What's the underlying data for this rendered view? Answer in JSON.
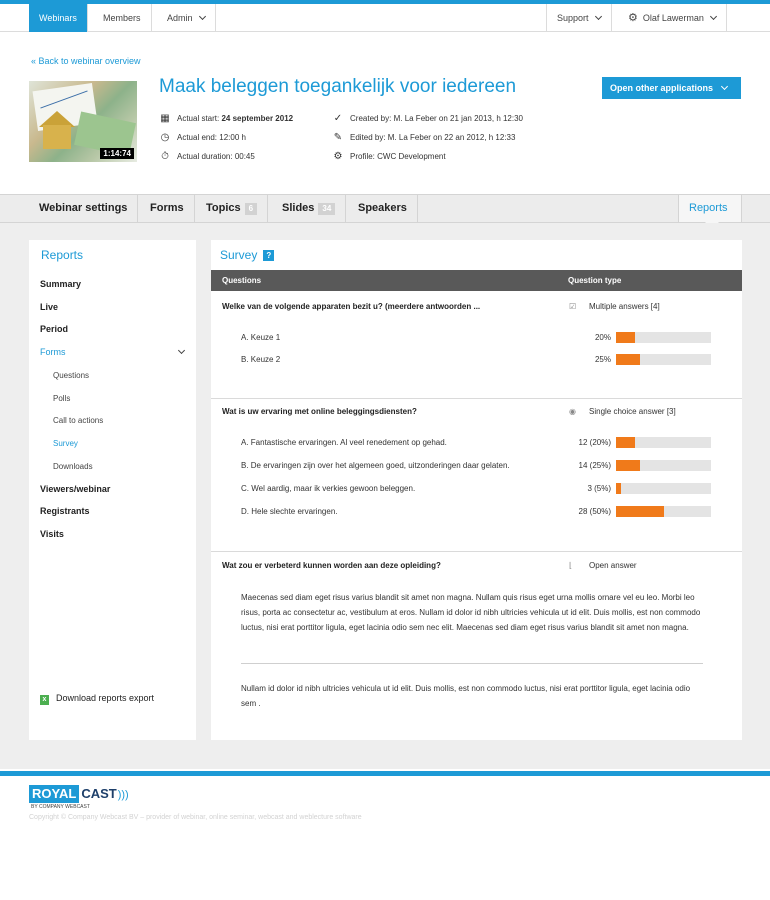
{
  "topnav": {
    "items": [
      "Webinars",
      "Members",
      "Admin"
    ],
    "support": "Support",
    "user": "Olaf Lawerman"
  },
  "back_link": "« Back to webinar overview",
  "webinar": {
    "title": "Maak beleggen toegankelijk voor iedereen",
    "duration_badge": "1:14:74",
    "actual_start_label": "Actual start:",
    "actual_start_value": "24 september 2012",
    "actual_end": "Actual end: 12:00 h",
    "actual_duration": "Actual duration: 00:45",
    "created_by": "Created by: M. La Feber on 21 jan 2013, h 12:30",
    "edited_by": "Edited by: M. La Feber on 22 an 2012, h 12:33",
    "profile": "Profile: CWC Development",
    "open_other_button": "Open other applications"
  },
  "tabs": {
    "webinar_settings": "Webinar settings",
    "forms": "Forms",
    "topics": "Topics",
    "topics_count": "6",
    "slides": "Slides",
    "slides_count": "34",
    "speakers": "Speakers",
    "reports": "Reports"
  },
  "sidebar": {
    "title": "Reports",
    "summary": "Summary",
    "live": "Live",
    "period": "Period",
    "forms": "Forms",
    "sub": [
      "Questions",
      "Polls",
      "Call to actions",
      "Survey",
      "Downloads"
    ],
    "viewers": "Viewers/webinar",
    "registrants": "Registrants",
    "visits": "Visits",
    "download": "Download reports export"
  },
  "survey": {
    "title": "Survey",
    "help": "?",
    "col_questions": "Questions",
    "col_type": "Question type",
    "q1": {
      "text": "Welke van de volgende apparaten bezit u? (meerdere antwoorden ...",
      "type": "Multiple answers [4]",
      "answers": [
        {
          "label": "A. Keuze 1",
          "stat": "20%",
          "pct": 20
        },
        {
          "label": "B. Keuze 2",
          "stat": "25%",
          "pct": 25
        }
      ]
    },
    "q2": {
      "text": "Wat is uw ervaring met online beleggingsdiensten?",
      "type": "Single choice answer [3]",
      "answers": [
        {
          "label": "A. Fantastische ervaringen. Al veel renedement op gehad.",
          "stat": "12 (20%)",
          "pct": 20
        },
        {
          "label": "B. De ervaringen zijn over het algemeen goed, uitzonderingen daar gelaten.",
          "stat": "14 (25%)",
          "pct": 25
        },
        {
          "label": "C. Wel aardig, maar ik verkies gewoon beleggen.",
          "stat": "3 (5%)",
          "pct": 5
        },
        {
          "label": "D. Hele slechte ervaringen.",
          "stat": "28 (50%)",
          "pct": 50
        }
      ]
    },
    "q3": {
      "text": "Wat zou er verbeterd kunnen worden aan deze opleiding?",
      "type": "Open answer",
      "responses": [
        "Maecenas sed diam eget risus varius blandit sit amet non magna. Nullam quis risus eget urna mollis ornare vel eu leo. Morbi leo risus, porta ac consectetur ac, vestibulum at eros. Nullam id dolor id nibh ultricies vehicula ut id elit. Duis mollis, est non commodo luctus, nisi erat porttitor ligula, eget lacinia odio sem nec elit. Maecenas sed diam eget risus varius blandit sit amet non magna.",
        "Nullam id dolor id nibh ultricies vehicula ut id elit. Duis mollis, est non commodo luctus, nisi erat porttitor ligula, eget lacinia odio sem ."
      ]
    }
  },
  "footer": {
    "logo_royal": "ROYAL",
    "logo_cast": "CAST",
    "logo_by": "BY COMPANY WEBCAST",
    "copyright": "Copyright © Company Webcast BV – provider of webinar, online seminar, webcast and weblecture software"
  },
  "colors": {
    "accent": "#1d9ad6",
    "bar": "#f07a1a",
    "bar_bg": "#e4e4e4",
    "table_head": "#595959"
  }
}
